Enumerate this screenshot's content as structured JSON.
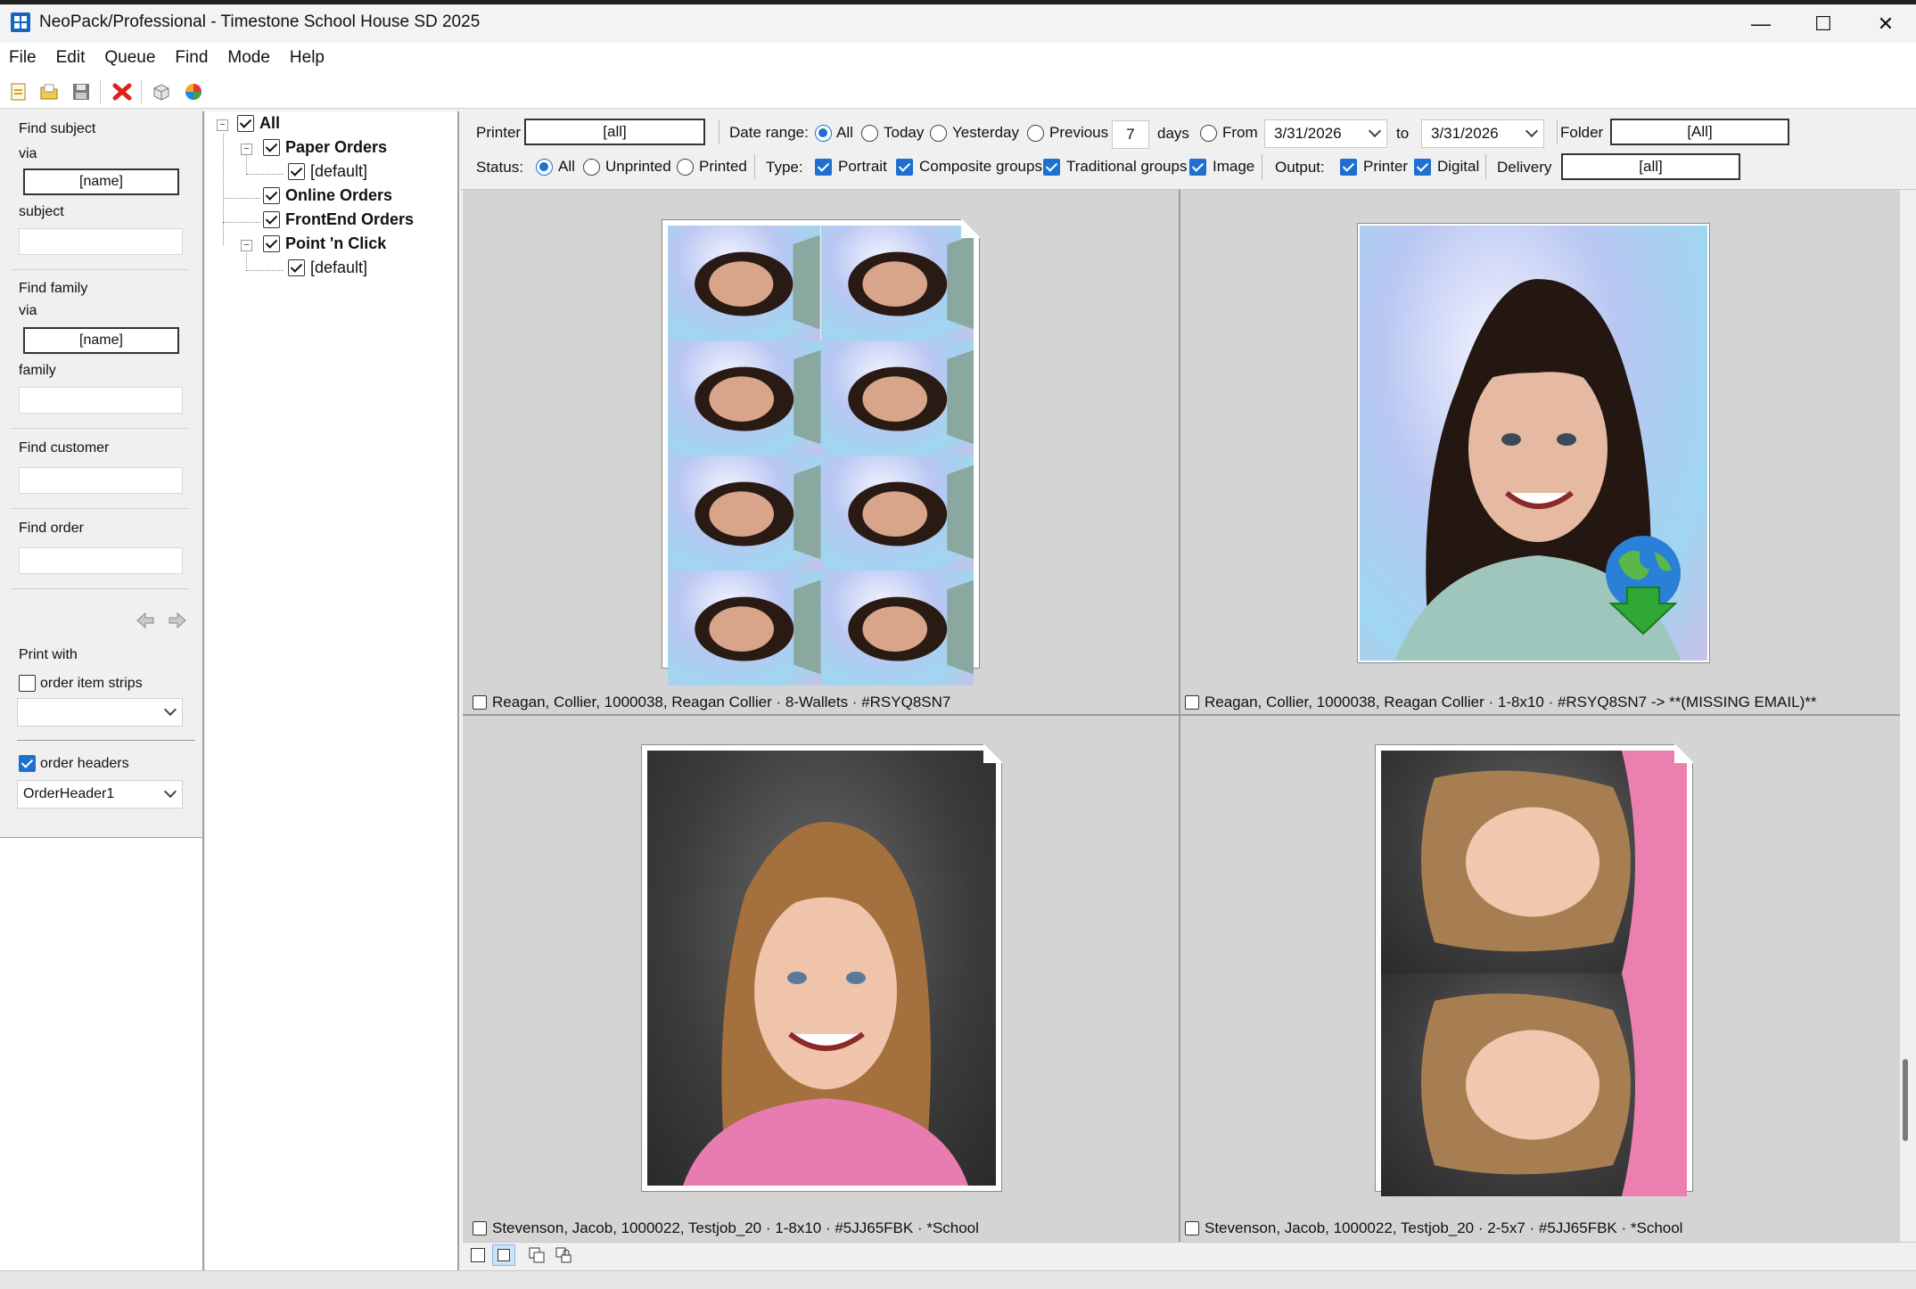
{
  "window": {
    "title": "NeoPack/Professional - Timestone School House SD 2025",
    "minimize_glyph": "—",
    "maximize_glyph": "☐",
    "close_glyph": "✕"
  },
  "menu": [
    "File",
    "Edit",
    "Queue",
    "Find",
    "Mode",
    "Help"
  ],
  "toolbar": {
    "icons": [
      "new-icon",
      "open-folder-icon",
      "save-icon",
      "delete-icon",
      "package-icon",
      "color-wheel-icon"
    ]
  },
  "left_panel": {
    "find_subject": {
      "label": "Find subject",
      "via_label": "via",
      "via_value": "[name]",
      "field_label": "subject",
      "field_value": ""
    },
    "find_family": {
      "label": "Find family",
      "via_label": "via",
      "via_value": "[name]",
      "field_label": "family",
      "field_value": ""
    },
    "find_customer": {
      "label": "Find customer",
      "value": ""
    },
    "find_order": {
      "label": "Find order",
      "value": ""
    },
    "print_with": {
      "label": "Print with",
      "order_item_strips": {
        "label": "order item strips",
        "checked": false,
        "select_value": ""
      },
      "order_headers": {
        "label": "order headers",
        "checked": true,
        "select_value": "OrderHeader1"
      }
    }
  },
  "tree": {
    "root": {
      "label": "All",
      "checked": true
    },
    "nodes": [
      {
        "label": "Paper Orders",
        "checked": true,
        "bold": true
      },
      {
        "label": "[default]",
        "checked": true,
        "bold": false
      },
      {
        "label": "Online Orders",
        "checked": true,
        "bold": true
      },
      {
        "label": "FrontEnd Orders",
        "checked": true,
        "bold": true
      },
      {
        "label": "Point 'n Click",
        "checked": true,
        "bold": true
      },
      {
        "label": "[default]",
        "checked": true,
        "bold": false
      }
    ]
  },
  "filters": {
    "printer_label": "Printer",
    "printer_value": "[all]",
    "date_range_label": "Date range:",
    "date_options": [
      "All",
      "Today",
      "Yesterday",
      "Previous"
    ],
    "date_selected": "All",
    "previous_days": "7",
    "days_label": "days",
    "from_label": "From",
    "from_date": "3/31/2026",
    "to_label": "to",
    "to_date": "3/31/2026",
    "folder_label": "Folder",
    "folder_value": "[All]",
    "status_label": "Status:",
    "status_options": [
      "All",
      "Unprinted",
      "Printed"
    ],
    "status_selected": "All",
    "type_label": "Type:",
    "type_options": [
      "Portrait",
      "Composite groups",
      "Traditional groups",
      "Image"
    ],
    "output_label": "Output:",
    "output_options": [
      "Printer",
      "Digital"
    ],
    "delivery_label": "Delivery",
    "delivery_value": "[all]"
  },
  "items": [
    {
      "caption": "Reagan, Collier, 1000038, Reagan Collier · 8-Wallets · #RSYQ8SN7",
      "checked": false
    },
    {
      "caption": "Reagan, Collier, 1000038, Reagan Collier · 1-8x10 · #RSYQ8SN7 ->  **(MISSING EMAIL)**",
      "checked": false
    },
    {
      "caption": "Stevenson, Jacob, 1000022, Testjob_20 · 1-8x10 · #5JJ65FBK · *School",
      "checked": false
    },
    {
      "caption": "Stevenson, Jacob, 1000022, Testjob_20 · 2-5x7 · #5JJ65FBK · *School",
      "checked": false
    }
  ],
  "colors": {
    "accent": "#1f6fd1",
    "grid_bg": "#d4d4d4",
    "download_green": "#2fa836",
    "globe_blue": "#2a7fd6"
  }
}
